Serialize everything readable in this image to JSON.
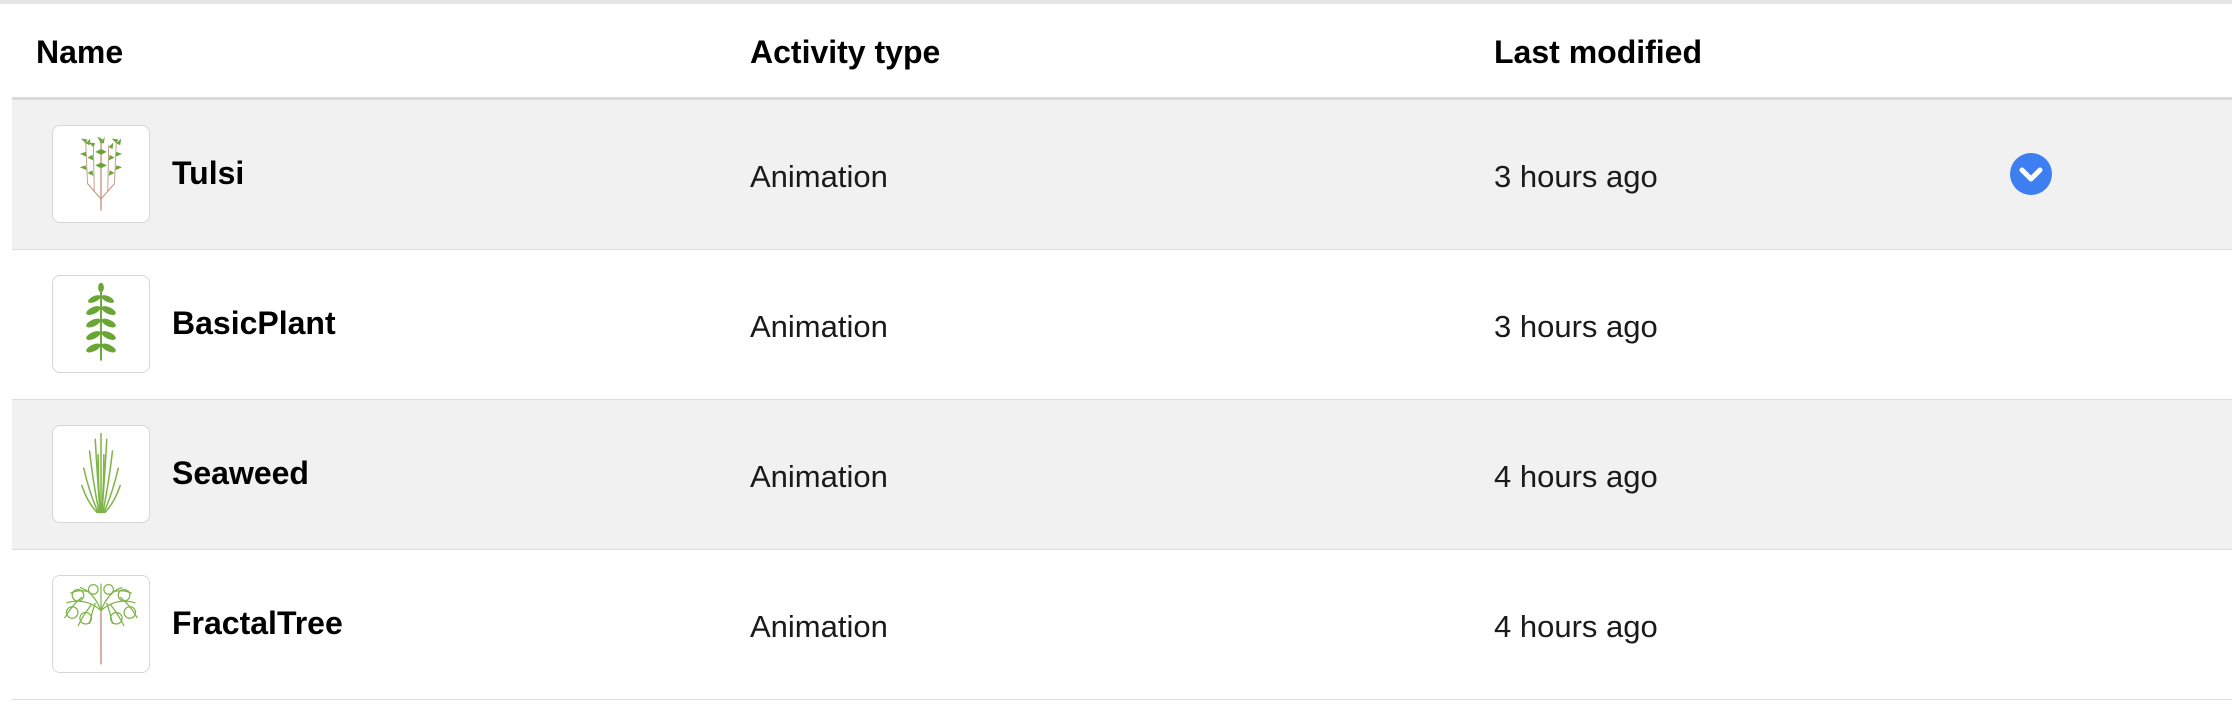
{
  "table": {
    "columns": {
      "name": "Name",
      "activity_type": "Activity type",
      "last_modified": "Last modified"
    },
    "rows": [
      {
        "name": "Tulsi",
        "activity_type": "Animation",
        "last_modified": "3 hours ago",
        "thumbnail_icon": "tulsi-plant-icon"
      },
      {
        "name": "BasicPlant",
        "activity_type": "Animation",
        "last_modified": "3 hours ago",
        "thumbnail_icon": "basic-plant-icon"
      },
      {
        "name": "Seaweed",
        "activity_type": "Animation",
        "last_modified": "4 hours ago",
        "thumbnail_icon": "seaweed-icon"
      },
      {
        "name": "FractalTree",
        "activity_type": "Animation",
        "last_modified": "4 hours ago",
        "thumbnail_icon": "fractal-tree-icon"
      }
    ],
    "row_menu_icon": "chevron-down-icon"
  },
  "colors": {
    "accent": "#3d7ff0",
    "row_shaded": "#f1f1f1",
    "leaf_green": "#6aa636",
    "stem_brown": "#c79a82"
  }
}
